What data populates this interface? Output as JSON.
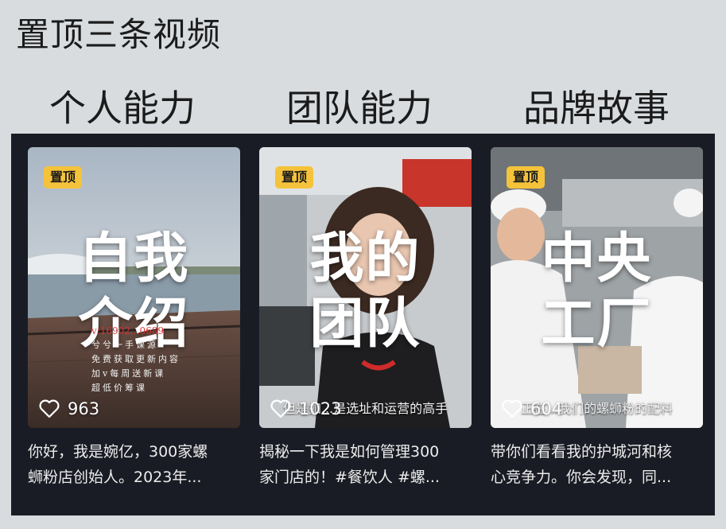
{
  "header": {
    "title": "置顶三条视频"
  },
  "sections": [
    "个人能力",
    "团队能力",
    "品牌故事"
  ],
  "colors": {
    "panel": "#1a1c25",
    "badge": "#f5c33b",
    "background": "#d8dcdf"
  },
  "cards": [
    {
      "badge": "置顶",
      "overlay_line1": "自我",
      "overlay_line2": "介绍",
      "likes": "963",
      "notes": [
        "v:16902...0689",
        "兮兮一手课源",
        "免费获取更新内容",
        "加v每周送新课",
        "超低价筹课"
      ],
      "subtitle": "",
      "desc_line1": "你好，我是婉亿，300家螺",
      "desc_line2": "蛳粉店创始人。2023年..."
    },
    {
      "badge": "置顶",
      "overlay_line1": "我的",
      "overlay_line2": "团队",
      "likes": "1023",
      "subtitle": "但是如...是选址和运营的高手",
      "desc_line1": "揭秘一下我是如何管理300",
      "desc_line2": "家门店的！#餐饮人 #螺..."
    },
    {
      "badge": "置顶",
      "overlay_line1": "中央",
      "overlay_line2": "工厂",
      "likes": "604",
      "subtitle": "正在...我们的螺蛳粉的配料",
      "desc_line1": "带你们看看我的护城河和核",
      "desc_line2": "心竞争力。你会发现，同..."
    }
  ]
}
